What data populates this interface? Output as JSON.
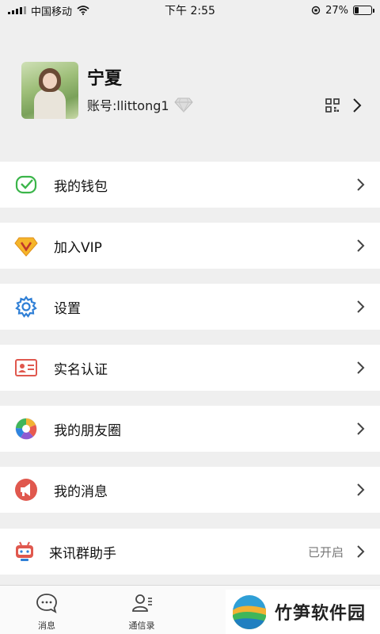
{
  "status_bar": {
    "carrier": "中国移动",
    "time": "下午 2:55",
    "battery": "27%",
    "battery_level": 0.27
  },
  "profile": {
    "name": "宁夏",
    "account": "账号:llittong1"
  },
  "menu": [
    {
      "label": "我的钱包",
      "icon": "wallet-icon"
    },
    {
      "label": "加入VIP",
      "icon": "vip-diamond-icon"
    },
    {
      "label": "设置",
      "icon": "settings-gear-icon"
    },
    {
      "label": "实名认证",
      "icon": "id-card-icon"
    },
    {
      "label": "我的朋友圈",
      "icon": "moments-aperture-icon"
    },
    {
      "label": "我的消息",
      "icon": "megaphone-icon"
    },
    {
      "label": "来讯群助手",
      "icon": "robot-icon",
      "value": "已开启"
    }
  ],
  "tabs": [
    {
      "label": "消息",
      "icon": "chat-bubble-icon"
    },
    {
      "label": "通信录",
      "icon": "contacts-icon"
    }
  ],
  "watermark": {
    "text": "竹笋软件园"
  }
}
